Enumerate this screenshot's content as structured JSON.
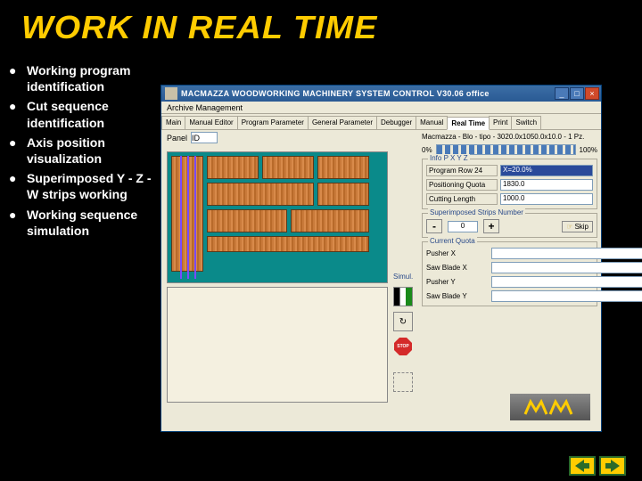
{
  "title": "WORK IN REAL TIME",
  "bullets": [
    "Working program identification",
    "Cut sequence identification",
    "Axis position visualization",
    "Superimposed Y - Z - W strips working",
    "Working sequence simulation"
  ],
  "app": {
    "window_title": "MACMAZZA WOODWORKING MACHINERY SYSTEM CONTROL  V30.06 office",
    "min": "_",
    "max": "□",
    "close": "×",
    "menubar": "Archive Management",
    "tabs": [
      "Main",
      "Manual Editor",
      "Program Parameter",
      "General Parameter",
      "Debugger",
      "Manual",
      "Real Time",
      "Print",
      "Switch"
    ],
    "active_tab": "Real Time",
    "panel_label": "Panel",
    "panel_value": "ID",
    "simul_label": "Simul.",
    "jobline": "Macmazza - Blo - tipo - 3020.0x1050.0x10.0 - 1 Pz.",
    "pct0": "0%",
    "pct100": "100%",
    "grp_info": "Info P X Y Z",
    "info_rows": [
      {
        "label": "Program Row 24",
        "value": "X=20.0%"
      },
      {
        "label": "Positioning Quota",
        "value": "1830.0"
      },
      {
        "label": "Cutting Length",
        "value": "1000.0"
      }
    ],
    "grp_strips": "Superimposed Strips Number",
    "strips_value": "0",
    "minus": "-",
    "plus": "+",
    "skip_label": "Skip",
    "grp_quota": "Current Quota",
    "quota_rows": [
      "Pusher X",
      "Saw Blade X",
      "Pusher Y",
      "Saw Blade Y"
    ],
    "stop": "STOP"
  }
}
